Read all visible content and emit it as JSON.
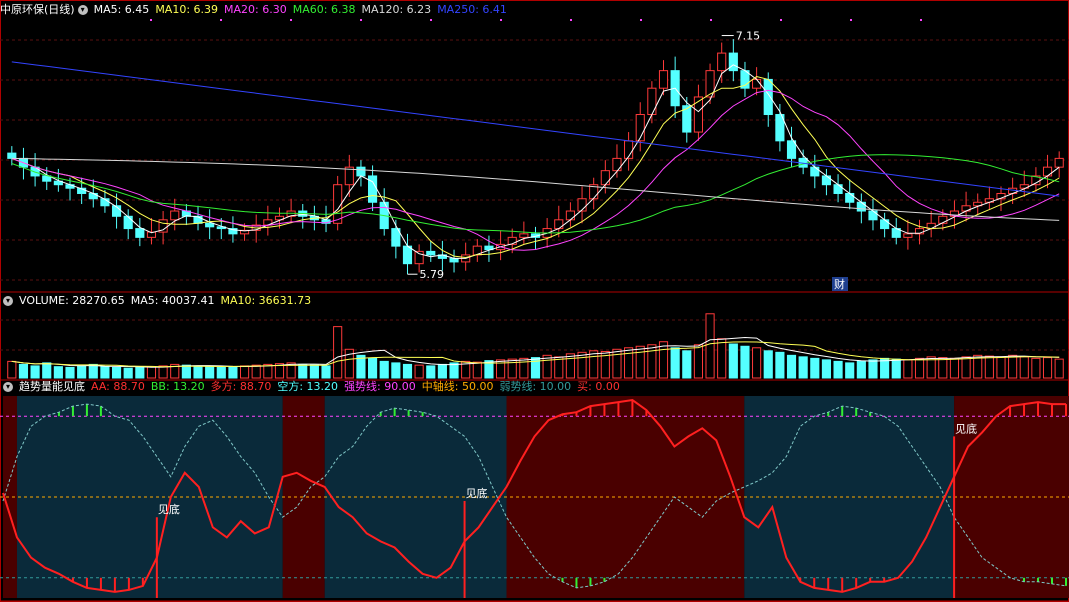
{
  "colors": {
    "bg": "#000000",
    "up": "#ff3a3a",
    "down": "#54ffff",
    "ma5": "#ffffff",
    "ma10": "#ffff55",
    "ma20": "#ff44ff",
    "ma60": "#33ee33",
    "ma120": "#d8d8d8",
    "ma250": "#3344ff",
    "panel_red": "#4a0000",
    "panel_blue": "#0a2a3a",
    "aa_line": "#ff2020",
    "bb_line": "#80c8c8"
  },
  "price_panel": {
    "stock_name": "中原环保(日线)",
    "ma_labels": [
      {
        "text": "MA5: 6.45",
        "color": "#ffffff"
      },
      {
        "text": "MA10: 6.39",
        "color": "#ffff55"
      },
      {
        "text": "MA20: 6.30",
        "color": "#ff44ff"
      },
      {
        "text": "MA60: 6.38",
        "color": "#33ee33"
      },
      {
        "text": "MA120: 6.23",
        "color": "#d8d8d8"
      },
      {
        "text": "MA250: 6.41",
        "color": "#3344ff"
      }
    ],
    "high_label": "7.15",
    "low_label": "5.79",
    "event_label": "财"
  },
  "volume_panel": {
    "labels": [
      {
        "text": "VOLUME: 28270.65",
        "color": "#ffffff"
      },
      {
        "text": "MA5: 40037.41",
        "color": "#ffffff"
      },
      {
        "text": "MA10: 36631.73",
        "color": "#ffff55"
      }
    ]
  },
  "indicator_panel": {
    "name": "趋势量能见底",
    "labels": [
      {
        "text": "AA: 88.70",
        "color": "#ff3030"
      },
      {
        "text": "BB: 13.20",
        "color": "#33ee33"
      },
      {
        "text": "多方: 88.70",
        "color": "#ff3030"
      },
      {
        "text": "空方: 13.20",
        "color": "#54ffff"
      },
      {
        "text": "强势线: 90.00",
        "color": "#ff44ff"
      },
      {
        "text": "中轴线: 50.00",
        "color": "#ffaa00"
      },
      {
        "text": "弱势线: 10.00",
        "color": "#339999"
      },
      {
        "text": "买: 0.00",
        "color": "#ff3030"
      }
    ],
    "signal_label": "见底"
  },
  "chart_data": [
    {
      "type": "candlestick",
      "title": "中原环保(日线)",
      "high_marker": 7.15,
      "low_marker": 5.79,
      "close_path": [
        6.45,
        6.4,
        6.35,
        6.32,
        6.3,
        6.28,
        6.25,
        6.22,
        6.18,
        6.12,
        6.05,
        6.0,
        6.03,
        6.1,
        6.15,
        6.12,
        6.08,
        6.06,
        6.05,
        6.02,
        6.04,
        6.07,
        6.1,
        6.12,
        6.15,
        6.12,
        6.1,
        6.08,
        6.3,
        6.4,
        6.35,
        6.2,
        6.05,
        5.95,
        5.85,
        5.92,
        5.9,
        5.88,
        5.86,
        5.9,
        5.95,
        5.93,
        5.96,
        6.0,
        6.02,
        6.0,
        6.05,
        6.1,
        6.15,
        6.22,
        6.3,
        6.38,
        6.45,
        6.55,
        6.7,
        6.85,
        6.95,
        6.75,
        6.6,
        6.8,
        6.95,
        7.05,
        6.95,
        6.85,
        6.9,
        6.7,
        6.55,
        6.45,
        6.4,
        6.35,
        6.3,
        6.25,
        6.2,
        6.15,
        6.1,
        6.05,
        6.0,
        6.02,
        6.05,
        6.08,
        6.12,
        6.15,
        6.18,
        6.2,
        6.22,
        6.25,
        6.28,
        6.3,
        6.35,
        6.4,
        6.45
      ]
    },
    {
      "type": "bar",
      "title": "VOLUME",
      "values": [
        22,
        18,
        16,
        20,
        15,
        14,
        16,
        18,
        15,
        14,
        13,
        14,
        15,
        16,
        18,
        17,
        16,
        15,
        14,
        15,
        16,
        17,
        18,
        19,
        20,
        18,
        17,
        16,
        68,
        38,
        30,
        26,
        22,
        20,
        18,
        17,
        16,
        18,
        20,
        22,
        21,
        23,
        24,
        25,
        26,
        27,
        30,
        28,
        32,
        34,
        36,
        35,
        38,
        40,
        42,
        44,
        48,
        40,
        36,
        44,
        85,
        52,
        45,
        42,
        40,
        36,
        34,
        30,
        28,
        26,
        24,
        22,
        20,
        22,
        24,
        26,
        25,
        24,
        26,
        28,
        27,
        26,
        28,
        30,
        29,
        28,
        30,
        28,
        26,
        27,
        25
      ]
    },
    {
      "type": "line",
      "title": "趋势量能见底",
      "ylim": [
        0,
        100
      ],
      "series": [
        {
          "name": "AA",
          "values": [
            52,
            30,
            20,
            15,
            12,
            8,
            5,
            4,
            3,
            4,
            6,
            20,
            50,
            62,
            55,
            35,
            30,
            38,
            32,
            35,
            60,
            62,
            58,
            55,
            45,
            40,
            32,
            28,
            25,
            18,
            12,
            10,
            15,
            28,
            35,
            45,
            55,
            68,
            80,
            88,
            91,
            92,
            95,
            96,
            97,
            98,
            93,
            85,
            75,
            80,
            84,
            78,
            60,
            40,
            35,
            45,
            20,
            8,
            5,
            4,
            3,
            5,
            8,
            8,
            10,
            18,
            30,
            45,
            60,
            75,
            82,
            90,
            95,
            96,
            97,
            96,
            96
          ]
        },
        {
          "name": "BB",
          "values": [
            48,
            70,
            85,
            90,
            92,
            95,
            96,
            95,
            90,
            88,
            80,
            70,
            60,
            75,
            85,
            88,
            80,
            70,
            62,
            50,
            40,
            45,
            55,
            60,
            70,
            75,
            85,
            92,
            94,
            93,
            92,
            90,
            85,
            80,
            70,
            55,
            40,
            30,
            20,
            12,
            8,
            5,
            6,
            8,
            12,
            20,
            30,
            40,
            50,
            45,
            40,
            48,
            52,
            55,
            58,
            62,
            70,
            85,
            90,
            92,
            95,
            94,
            92,
            90,
            85,
            75,
            65,
            55,
            40,
            30,
            20,
            15,
            10,
            8,
            8,
            7,
            6
          ]
        }
      ]
    }
  ]
}
